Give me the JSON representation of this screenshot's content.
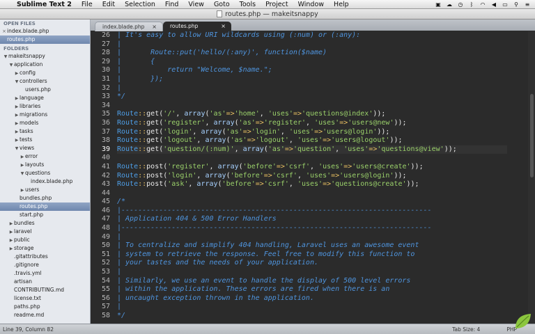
{
  "menubar": {
    "app_name": "Sublime Text 2",
    "items": [
      "File",
      "Edit",
      "Selection",
      "Find",
      "View",
      "Goto",
      "Tools",
      "Project",
      "Window",
      "Help"
    ]
  },
  "window": {
    "title": "routes.php — makeitsnappy"
  },
  "sidebar": {
    "open_files_heading": "OPEN FILES",
    "open_files": [
      "index.blade.php",
      "routes.php"
    ],
    "folders_heading": "FOLDERS",
    "tree": [
      {
        "label": "makeitsnappy",
        "depth": 0,
        "kind": "open"
      },
      {
        "label": "application",
        "depth": 1,
        "kind": "open"
      },
      {
        "label": "config",
        "depth": 2,
        "kind": "closed"
      },
      {
        "label": "controllers",
        "depth": 2,
        "kind": "open"
      },
      {
        "label": "users.php",
        "depth": 3,
        "kind": "file"
      },
      {
        "label": "language",
        "depth": 2,
        "kind": "closed"
      },
      {
        "label": "libraries",
        "depth": 2,
        "kind": "closed"
      },
      {
        "label": "migrations",
        "depth": 2,
        "kind": "closed"
      },
      {
        "label": "models",
        "depth": 2,
        "kind": "closed"
      },
      {
        "label": "tasks",
        "depth": 2,
        "kind": "closed"
      },
      {
        "label": "tests",
        "depth": 2,
        "kind": "closed"
      },
      {
        "label": "views",
        "depth": 2,
        "kind": "open"
      },
      {
        "label": "error",
        "depth": 3,
        "kind": "closed"
      },
      {
        "label": "layouts",
        "depth": 3,
        "kind": "closed"
      },
      {
        "label": "questions",
        "depth": 3,
        "kind": "open"
      },
      {
        "label": "index.blade.php",
        "depth": 4,
        "kind": "file"
      },
      {
        "label": "users",
        "depth": 3,
        "kind": "closed"
      },
      {
        "label": "bundles.php",
        "depth": 2,
        "kind": "file"
      },
      {
        "label": "routes.php",
        "depth": 2,
        "kind": "file",
        "selected": true
      },
      {
        "label": "start.php",
        "depth": 2,
        "kind": "file"
      },
      {
        "label": "bundles",
        "depth": 1,
        "kind": "closed"
      },
      {
        "label": "laravel",
        "depth": 1,
        "kind": "closed"
      },
      {
        "label": "public",
        "depth": 1,
        "kind": "closed"
      },
      {
        "label": "storage",
        "depth": 1,
        "kind": "closed"
      },
      {
        "label": ".gitattributes",
        "depth": 1,
        "kind": "file"
      },
      {
        "label": ".gitignore",
        "depth": 1,
        "kind": "file"
      },
      {
        "label": ".travis.yml",
        "depth": 1,
        "kind": "file"
      },
      {
        "label": "artisan",
        "depth": 1,
        "kind": "file"
      },
      {
        "label": "CONTRIBUTING.md",
        "depth": 1,
        "kind": "file"
      },
      {
        "label": "license.txt",
        "depth": 1,
        "kind": "file"
      },
      {
        "label": "paths.php",
        "depth": 1,
        "kind": "file"
      },
      {
        "label": "readme.md",
        "depth": 1,
        "kind": "file"
      }
    ]
  },
  "tabs": [
    {
      "label": "index.blade.php",
      "active": false
    },
    {
      "label": "routes.php",
      "active": true
    }
  ],
  "editor": {
    "current_line": 39,
    "lines": [
      {
        "n": 26,
        "segs": [
          [
            "c-com",
            "| It's easy to allow URI wildcards using (:num) or (:any):"
          ]
        ]
      },
      {
        "n": 27,
        "segs": [
          [
            "c-com",
            "|"
          ]
        ]
      },
      {
        "n": 28,
        "segs": [
          [
            "c-com",
            "|       Route::put('hello/(:any)', function($name)"
          ]
        ]
      },
      {
        "n": 29,
        "segs": [
          [
            "c-com",
            "|       {"
          ]
        ]
      },
      {
        "n": 30,
        "segs": [
          [
            "c-com",
            "|           return \"Welcome, $name.\";"
          ]
        ]
      },
      {
        "n": 31,
        "segs": [
          [
            "c-com",
            "|       });"
          ]
        ]
      },
      {
        "n": 32,
        "segs": [
          [
            "c-com",
            "|"
          ]
        ]
      },
      {
        "n": 33,
        "segs": [
          [
            "c-com",
            "*/"
          ]
        ]
      },
      {
        "n": 34,
        "segs": []
      },
      {
        "n": 35,
        "segs": [
          [
            "c-kw",
            "Route"
          ],
          [
            "c-op",
            "::"
          ],
          [
            "c-fn",
            "get("
          ],
          [
            "c-str",
            "'/'"
          ],
          [
            "c-fn",
            ", "
          ],
          [
            "c-cls",
            "array"
          ],
          [
            "c-fn",
            "("
          ],
          [
            "c-str",
            "'as'"
          ],
          [
            "c-op",
            "=>"
          ],
          [
            "c-str",
            "'home'"
          ],
          [
            "c-fn",
            ", "
          ],
          [
            "c-str",
            "'uses'"
          ],
          [
            "c-op",
            "=>"
          ],
          [
            "c-str",
            "'questions@index'"
          ],
          [
            "c-fn",
            "));"
          ]
        ]
      },
      {
        "n": 36,
        "segs": [
          [
            "c-kw",
            "Route"
          ],
          [
            "c-op",
            "::"
          ],
          [
            "c-fn",
            "get("
          ],
          [
            "c-str",
            "'register'"
          ],
          [
            "c-fn",
            ", "
          ],
          [
            "c-cls",
            "array"
          ],
          [
            "c-fn",
            "("
          ],
          [
            "c-str",
            "'as'"
          ],
          [
            "c-op",
            "=>"
          ],
          [
            "c-str",
            "'register'"
          ],
          [
            "c-fn",
            ", "
          ],
          [
            "c-str",
            "'uses'"
          ],
          [
            "c-op",
            "=>"
          ],
          [
            "c-str",
            "'users@new'"
          ],
          [
            "c-fn",
            "));"
          ]
        ]
      },
      {
        "n": 37,
        "segs": [
          [
            "c-kw",
            "Route"
          ],
          [
            "c-op",
            "::"
          ],
          [
            "c-fn",
            "get("
          ],
          [
            "c-str",
            "'login'"
          ],
          [
            "c-fn",
            ", "
          ],
          [
            "c-cls",
            "array"
          ],
          [
            "c-fn",
            "("
          ],
          [
            "c-str",
            "'as'"
          ],
          [
            "c-op",
            "=>"
          ],
          [
            "c-str",
            "'login'"
          ],
          [
            "c-fn",
            ", "
          ],
          [
            "c-str",
            "'uses'"
          ],
          [
            "c-op",
            "=>"
          ],
          [
            "c-str",
            "'users@login'"
          ],
          [
            "c-fn",
            "));"
          ]
        ]
      },
      {
        "n": 38,
        "segs": [
          [
            "c-kw",
            "Route"
          ],
          [
            "c-op",
            "::"
          ],
          [
            "c-fn",
            "get("
          ],
          [
            "c-str",
            "'logout'"
          ],
          [
            "c-fn",
            ", "
          ],
          [
            "c-cls",
            "array"
          ],
          [
            "c-fn",
            "("
          ],
          [
            "c-str",
            "'as'"
          ],
          [
            "c-op",
            "=>"
          ],
          [
            "c-str",
            "'logout'"
          ],
          [
            "c-fn",
            ", "
          ],
          [
            "c-str",
            "'uses'"
          ],
          [
            "c-op",
            "=>"
          ],
          [
            "c-str",
            "'users@logout'"
          ],
          [
            "c-fn",
            "));"
          ]
        ]
      },
      {
        "n": 39,
        "segs": [
          [
            "c-kw",
            "Route"
          ],
          [
            "c-op",
            "::"
          ],
          [
            "c-fn",
            "get("
          ],
          [
            "c-str",
            "'question/(:num)'"
          ],
          [
            "c-fn",
            ", "
          ],
          [
            "c-cls",
            "array"
          ],
          [
            "c-fn",
            "("
          ],
          [
            "c-str",
            "'as'"
          ],
          [
            "c-op",
            "=>"
          ],
          [
            "c-str",
            "'question'"
          ],
          [
            "c-fn",
            ", "
          ],
          [
            "c-str",
            "'uses'"
          ],
          [
            "c-op",
            "=>"
          ],
          [
            "c-str",
            "'questions@view'"
          ],
          [
            "c-fn",
            "));"
          ]
        ]
      },
      {
        "n": 40,
        "segs": []
      },
      {
        "n": 41,
        "segs": [
          [
            "c-kw",
            "Route"
          ],
          [
            "c-op",
            "::"
          ],
          [
            "c-fn",
            "post("
          ],
          [
            "c-str",
            "'register'"
          ],
          [
            "c-fn",
            ", "
          ],
          [
            "c-cls",
            "array"
          ],
          [
            "c-fn",
            "("
          ],
          [
            "c-str",
            "'before'"
          ],
          [
            "c-op",
            "=>"
          ],
          [
            "c-str",
            "'csrf'"
          ],
          [
            "c-fn",
            ", "
          ],
          [
            "c-str",
            "'uses'"
          ],
          [
            "c-op",
            "=>"
          ],
          [
            "c-str",
            "'users@create'"
          ],
          [
            "c-fn",
            "));"
          ]
        ]
      },
      {
        "n": 42,
        "segs": [
          [
            "c-kw",
            "Route"
          ],
          [
            "c-op",
            "::"
          ],
          [
            "c-fn",
            "post("
          ],
          [
            "c-str",
            "'login'"
          ],
          [
            "c-fn",
            ", "
          ],
          [
            "c-cls",
            "array"
          ],
          [
            "c-fn",
            "("
          ],
          [
            "c-str",
            "'before'"
          ],
          [
            "c-op",
            "=>"
          ],
          [
            "c-str",
            "'csrf'"
          ],
          [
            "c-fn",
            ", "
          ],
          [
            "c-str",
            "'uses'"
          ],
          [
            "c-op",
            "=>"
          ],
          [
            "c-str",
            "'users@login'"
          ],
          [
            "c-fn",
            "));"
          ]
        ]
      },
      {
        "n": 43,
        "segs": [
          [
            "c-kw",
            "Route"
          ],
          [
            "c-op",
            "::"
          ],
          [
            "c-fn",
            "post("
          ],
          [
            "c-str",
            "'ask'"
          ],
          [
            "c-fn",
            ", "
          ],
          [
            "c-cls",
            "array"
          ],
          [
            "c-fn",
            "("
          ],
          [
            "c-str",
            "'before'"
          ],
          [
            "c-op",
            "=>"
          ],
          [
            "c-str",
            "'csrf'"
          ],
          [
            "c-fn",
            ", "
          ],
          [
            "c-str",
            "'uses'"
          ],
          [
            "c-op",
            "=>"
          ],
          [
            "c-str",
            "'questions@create'"
          ],
          [
            "c-fn",
            "));"
          ]
        ]
      },
      {
        "n": 44,
        "segs": []
      },
      {
        "n": 45,
        "segs": [
          [
            "c-com",
            "/*"
          ]
        ]
      },
      {
        "n": 46,
        "segs": [
          [
            "c-com",
            "|--------------------------------------------------------------------------"
          ]
        ]
      },
      {
        "n": 47,
        "segs": [
          [
            "c-com",
            "| Application 404 & 500 Error Handlers"
          ]
        ]
      },
      {
        "n": 48,
        "segs": [
          [
            "c-com",
            "|--------------------------------------------------------------------------"
          ]
        ]
      },
      {
        "n": 49,
        "segs": [
          [
            "c-com",
            "|"
          ]
        ]
      },
      {
        "n": 50,
        "segs": [
          [
            "c-com",
            "| To centralize and simplify 404 handling, Laravel uses an awesome event"
          ]
        ]
      },
      {
        "n": 51,
        "segs": [
          [
            "c-com",
            "| system to retrieve the response. Feel free to modify this function to"
          ]
        ]
      },
      {
        "n": 52,
        "segs": [
          [
            "c-com",
            "| your tastes and the needs of your application."
          ]
        ]
      },
      {
        "n": 53,
        "segs": [
          [
            "c-com",
            "|"
          ]
        ]
      },
      {
        "n": 54,
        "segs": [
          [
            "c-com",
            "| Similarly, we use an event to handle the display of 500 level errors"
          ]
        ]
      },
      {
        "n": 55,
        "segs": [
          [
            "c-com",
            "| within the application. These errors are fired when there is an"
          ]
        ]
      },
      {
        "n": 56,
        "segs": [
          [
            "c-com",
            "| uncaught exception thrown in the application."
          ]
        ]
      },
      {
        "n": 57,
        "segs": [
          [
            "c-com",
            "|"
          ]
        ]
      },
      {
        "n": 58,
        "segs": [
          [
            "c-com",
            "*/"
          ]
        ]
      }
    ]
  },
  "statusbar": {
    "position": "Line 39, Column 82",
    "tab_size": "Tab Size: 4",
    "syntax": "PHP"
  },
  "colors": {
    "editor_bg": "#2b2b2b",
    "comment": "#4f95df",
    "string": "#9ad06a",
    "operator": "#e9c062",
    "selection": "#7089ae"
  }
}
